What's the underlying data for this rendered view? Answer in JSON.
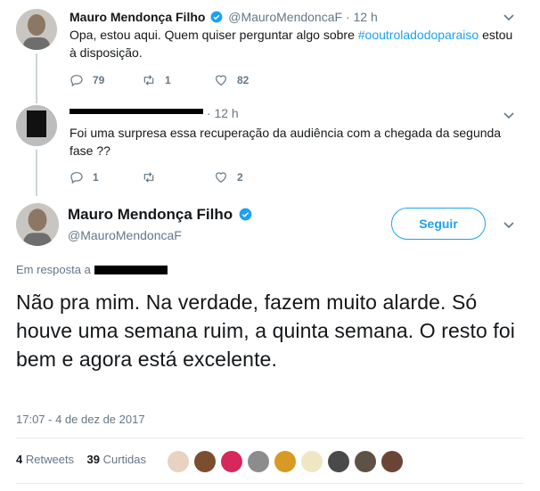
{
  "tweet1": {
    "name": "Mauro Mendonça Filho",
    "handle": "@MauroMendoncaF",
    "dot": "·",
    "time": "12 h",
    "text_before": "Opa, estou aqui. Quem quiser perguntar algo sobre ",
    "hashtag": "#ooutroladodoparaiso",
    "text_after": " estou à disposição.",
    "replies": "79",
    "retweets": "1",
    "likes": "82"
  },
  "tweet2": {
    "dot": "·",
    "time": "12 h",
    "text": "Foi uma surpresa essa recuperação da audiência com a chegada da segunda fase ??",
    "replies": "1",
    "retweets": "",
    "likes": "2"
  },
  "main": {
    "name": "Mauro Mendonça Filho",
    "handle": "@MauroMendoncaF",
    "follow_label": "Seguir",
    "reply_prefix": "Em resposta a",
    "text": "Não pra mim. Na verdade, fazem muito alarde. Só houve uma semana ruim, a quinta semana. O resto foi bem e agora está excelente.",
    "timestamp": "17:07 - 4 de dez de 2017",
    "retweets_count": "4",
    "retweets_label": "Retweets",
    "likes_count": "39",
    "likes_label": "Curtidas"
  },
  "colors": {
    "accent": "#1da1f2",
    "secondary_text": "#657786",
    "divider": "#e6ecf0"
  },
  "icons": [
    "reply-icon",
    "retweet-icon",
    "like-icon",
    "verified-icon",
    "chevron-down-icon"
  ]
}
